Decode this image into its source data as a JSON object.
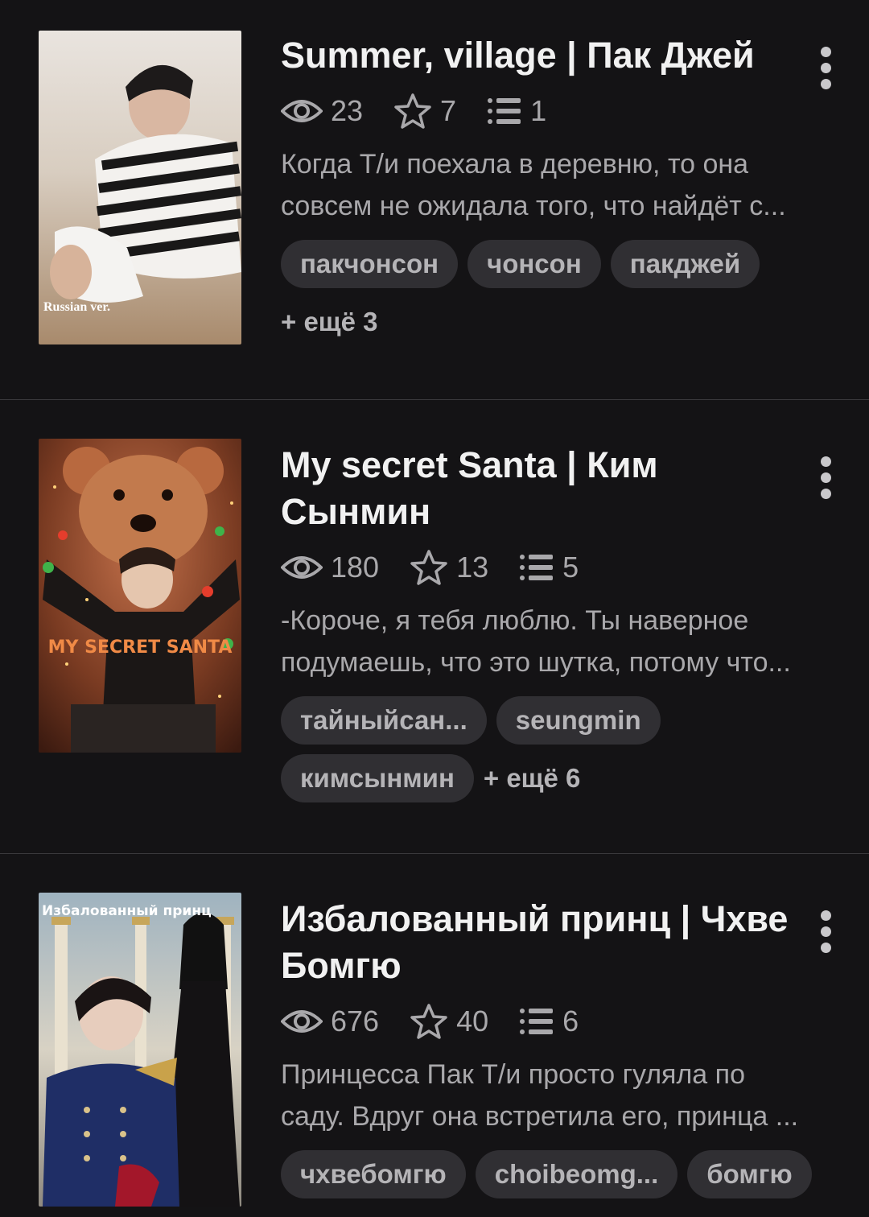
{
  "stories": [
    {
      "title": "Summer, village | Пак Джей",
      "views": "23",
      "stars": "7",
      "chapters": "1",
      "desc_line1": "Когда Т/и поехала в деревню, то она",
      "desc_line2": "совсем не ожидала того, что найдёт  с...",
      "tags": [
        "пакчонсон",
        "чонсон",
        "пакджей"
      ],
      "more": "+ ещё 3",
      "cover_text": "Russian ver."
    },
    {
      "title": "My secret Santa | Ким Сынмин",
      "views": "180",
      "stars": "13",
      "chapters": "5",
      "desc_line1": "-Короче, я тебя люблю. Ты наверное",
      "desc_line2": "подумаешь, что это шутка, потому что...",
      "tags": [
        "тайныйсан...",
        "seungmin",
        "кимсынмин"
      ],
      "more": "+ ещё 6",
      "cover_text": "MY SECRET SANTA"
    },
    {
      "title": "Избалованный принц | Чхве Бомгю",
      "views": "676",
      "stars": "40",
      "chapters": "6",
      "desc_line1": "Принцесса Пак Т/и просто гуляла по",
      "desc_line2": "саду. Вдруг она встретила его, принца ...",
      "tags": [
        "чхвебомгю",
        "choibeomg...",
        "бомгю"
      ],
      "more": "",
      "cover_text": "Избалованный принц"
    }
  ],
  "icons": {
    "views": "eye-icon",
    "stars": "star-icon",
    "chapters": "list-icon",
    "menu": "more-vertical-icon"
  },
  "colors": {
    "background": "#141315",
    "tag_bg": "#302f33",
    "muted_text": "#a9a8ab"
  }
}
